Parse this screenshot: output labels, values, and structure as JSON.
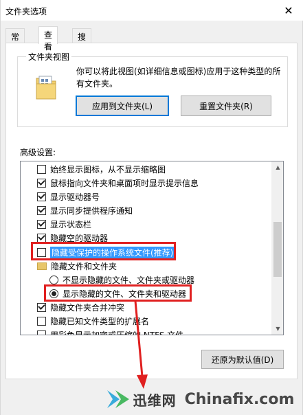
{
  "window": {
    "title": "文件夹选项",
    "close_glyph": "✕"
  },
  "tabs": [
    {
      "label": "常规",
      "active": false
    },
    {
      "label": "查看",
      "active": true
    },
    {
      "label": "搜索",
      "active": false
    }
  ],
  "folder_views": {
    "legend": "文件夹视图",
    "description": "你可以将此视图(如详细信息或图标)应用于这种类型的所有文件夹。",
    "apply_button": "应用到文件夹(L)",
    "reset_button": "重置文件夹(R)"
  },
  "advanced": {
    "label": "高级设置:",
    "items": [
      {
        "type": "checkbox",
        "checked": false,
        "label": "始终显示图标，从不显示缩略图"
      },
      {
        "type": "checkbox",
        "checked": true,
        "label": "鼠标指向文件夹和桌面项时显示提示信息"
      },
      {
        "type": "checkbox",
        "checked": true,
        "label": "显示驱动器号"
      },
      {
        "type": "checkbox",
        "checked": true,
        "label": "显示同步提供程序通知"
      },
      {
        "type": "checkbox",
        "checked": true,
        "label": "显示状态栏"
      },
      {
        "type": "checkbox",
        "checked": true,
        "label": "隐藏空的驱动器"
      },
      {
        "type": "checkbox",
        "checked": false,
        "label": "隐藏受保护的操作系统文件(推荐)",
        "selected": true
      },
      {
        "type": "folder",
        "label": "隐藏文件和文件夹"
      },
      {
        "type": "radio",
        "checked": false,
        "label": "不显示隐藏的文件、文件夹或驱动器"
      },
      {
        "type": "radio",
        "checked": true,
        "label": "显示隐藏的文件、文件夹和驱动器"
      },
      {
        "type": "checkbox",
        "checked": true,
        "label": "隐藏文件夹合并冲突"
      },
      {
        "type": "checkbox",
        "checked": false,
        "label": "隐藏已知文件类型的扩展名"
      },
      {
        "type": "checkbox",
        "checked": false,
        "label": "用彩色显示加密或压缩的 NTFS 文件"
      }
    ],
    "restore_button": "还原为默认值(D)"
  },
  "watermark": {
    "cn": "迅维网",
    "en": "Chinafix.com"
  },
  "colors": {
    "highlight": "#3399ff",
    "annotation": "#e02020",
    "focus": "#0078d7"
  }
}
